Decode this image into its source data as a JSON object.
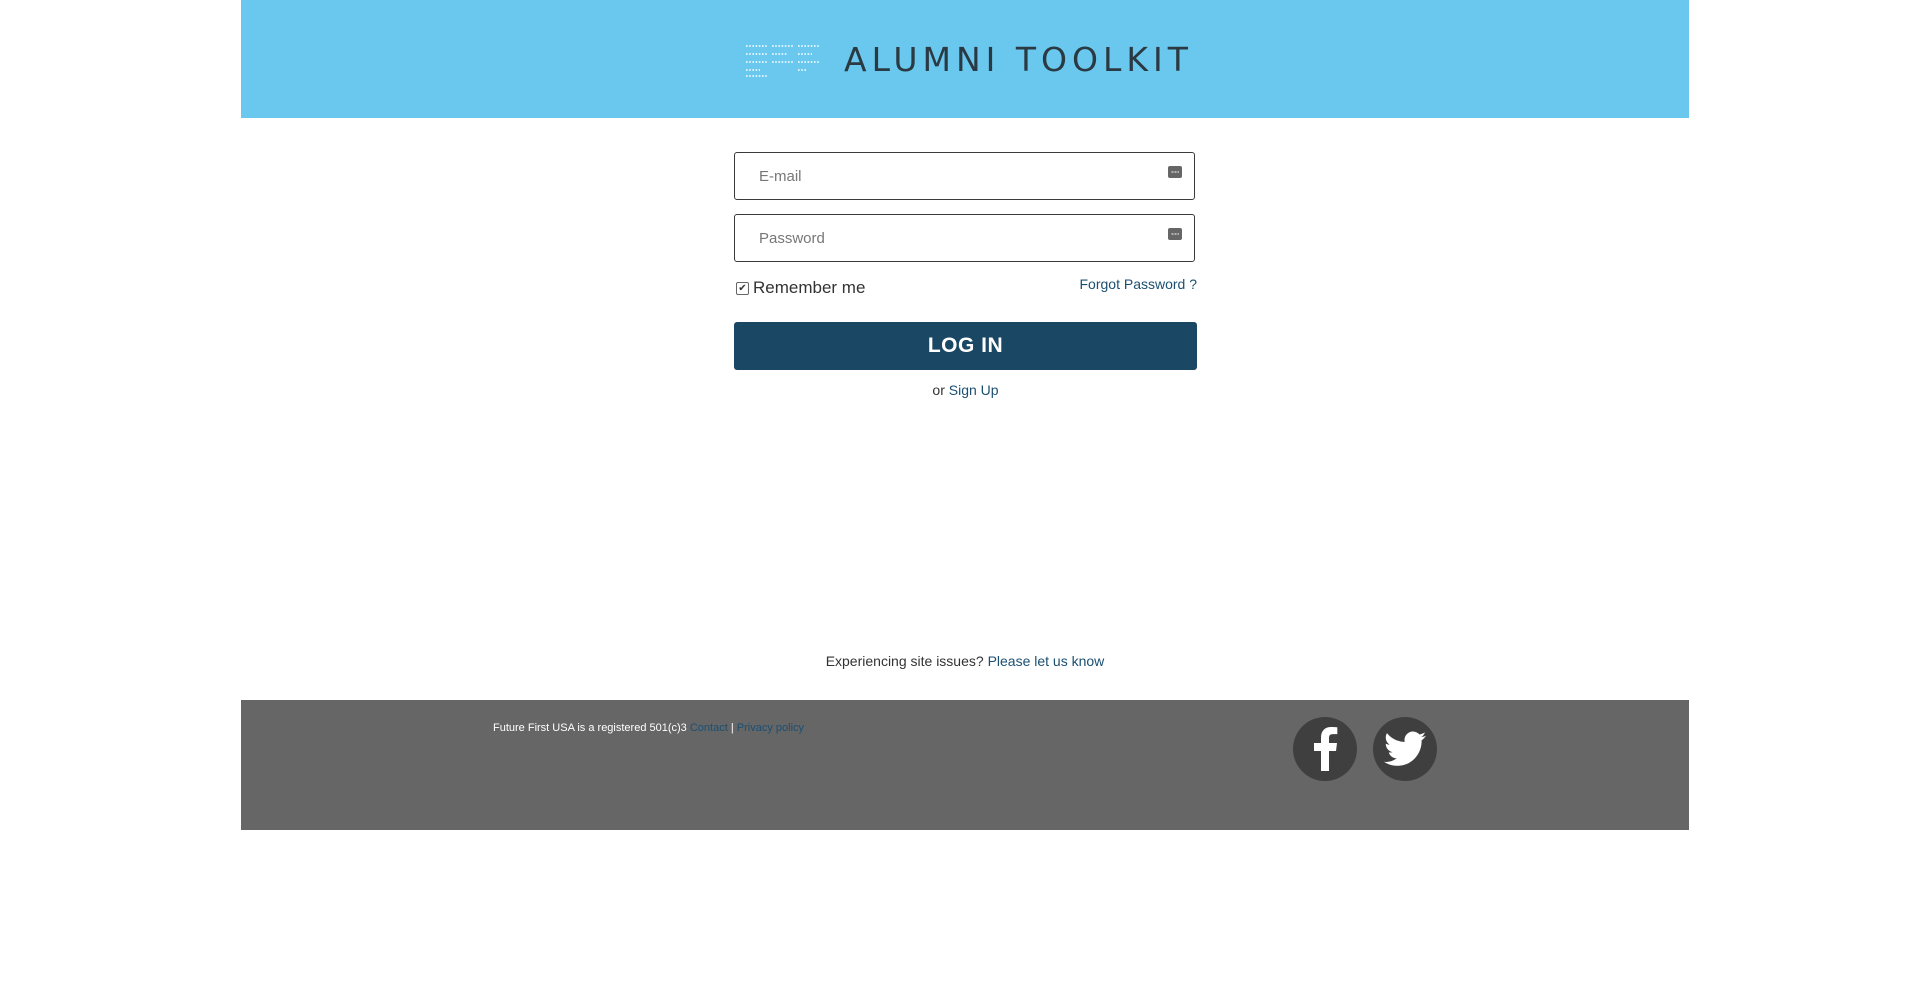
{
  "header": {
    "logo_text": "ALUMNI TOOLKIT",
    "background_color": "#6ac8ef"
  },
  "login_form": {
    "email_placeholder": "E-mail",
    "password_placeholder": "Password",
    "remember_label": "Remember me",
    "remember_checked": true,
    "forgot_label": "Forgot Password ?",
    "login_label": "LOG IN",
    "signup_prefix": "or",
    "signup_label": "Sign Up",
    "button_color": "#1a4763"
  },
  "site_issues": {
    "text": "Experiencing site issues?",
    "link_label": "Please let us know"
  },
  "footer": {
    "text": "Future First USA is a registered 501(c)3",
    "contact_label": "Contact",
    "separator": "|",
    "privacy_label": "Privacy policy",
    "background_color": "#666666",
    "social": [
      {
        "icon": "facebook-icon"
      },
      {
        "icon": "twitter-icon"
      }
    ]
  }
}
